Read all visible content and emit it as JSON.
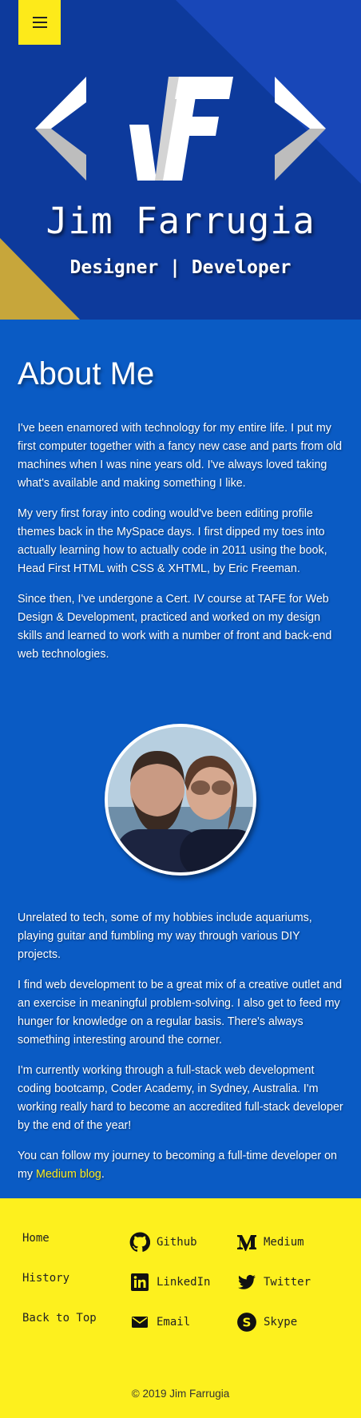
{
  "hero": {
    "name": "Jim Farrugia",
    "tagline": "Designer | Developer"
  },
  "about": {
    "heading": "About Me",
    "paragraphs": [
      "I've been enamored with technology for my entire life. I put my first computer together with a fancy new case and parts from old machines when I was nine years old. I've always loved taking what's available and making something I like.",
      "My very first foray into coding would've been editing profile themes back in the MySpace days. I first dipped my toes into actually learning how to actually code in 2011 using the book, Head First HTML with CSS & XHTML, by Eric Freeman.",
      "Since then, I've undergone a Cert. IV course at TAFE for Web Design & Development, practiced and worked on my design skills and learned to work with a number of front and back-end web technologies.",
      "Unrelated to tech, some of my hobbies include aquariums, playing guitar and fumbling my way through various DIY projects.",
      "I find web development to be a great mix of a creative outlet and an exercise in meaningful problem-solving. I also get to feed my hunger for knowledge on a regular basis. There's always something interesting around the corner.",
      "I'm currently working through a full-stack web development coding bootcamp, Coder Academy, in Sydney, Australia. I'm working really hard to become an accredited full-stack developer by the end of the year!"
    ],
    "follow_prefix": "You can follow my journey to becoming a full-time developer on my ",
    "follow_link": "Medium blog",
    "follow_suffix": "."
  },
  "footer": {
    "nav": [
      "Home",
      "History",
      "Back to Top"
    ],
    "social_left": [
      {
        "label": "Github",
        "icon": "github-icon"
      },
      {
        "label": "LinkedIn",
        "icon": "linkedin-icon"
      },
      {
        "label": "Email",
        "icon": "email-icon"
      }
    ],
    "social_right": [
      {
        "label": "Medium",
        "icon": "medium-icon"
      },
      {
        "label": "Twitter",
        "icon": "twitter-icon"
      },
      {
        "label": "Skype",
        "icon": "skype-icon"
      }
    ],
    "copyright": "© 2019 Jim Farrugia"
  },
  "colors": {
    "hero_bg": "#0d3a9c",
    "about_bg": "#0a5bc4",
    "accent_yellow": "#fdea1a",
    "link_yellow": "#fdea1a"
  }
}
